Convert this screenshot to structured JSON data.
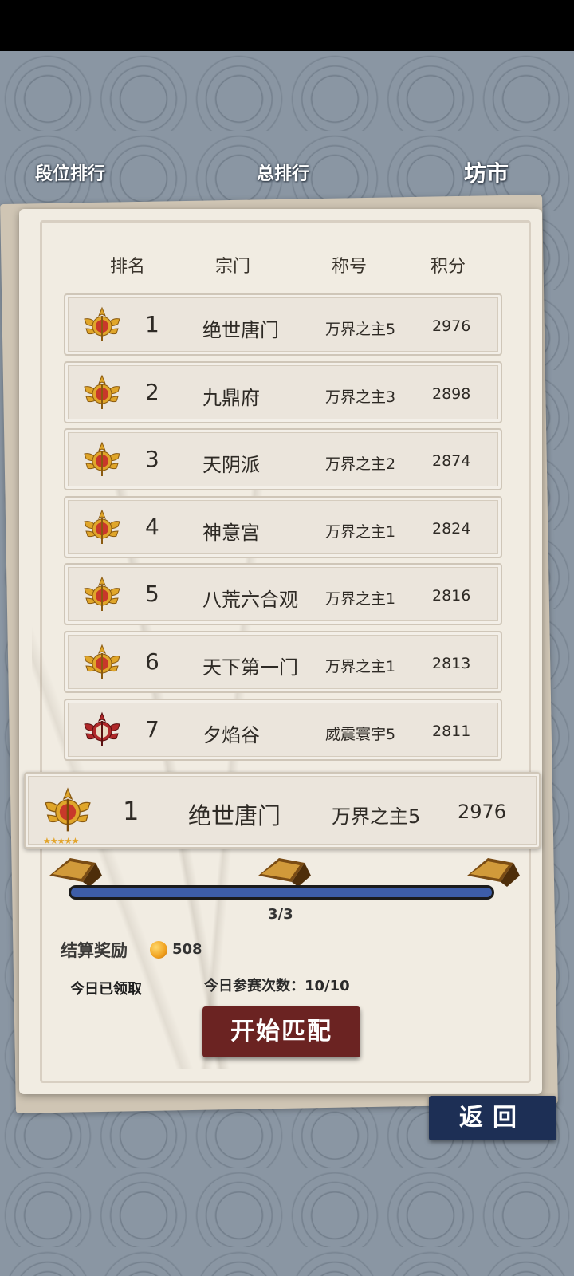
{
  "tabs": {
    "rank_tier": "段位排行",
    "rank_total": "总排行",
    "market": "坊市"
  },
  "table": {
    "headers": [
      "排名",
      "宗门",
      "称号",
      "积分"
    ],
    "rows": [
      {
        "rank": "1",
        "sect": "绝世唐门",
        "title": "万界之主5",
        "score": "2976",
        "medal": "gold"
      },
      {
        "rank": "2",
        "sect": "九鼎府",
        "title": "万界之主3",
        "score": "2898",
        "medal": "gold"
      },
      {
        "rank": "3",
        "sect": "天阴派",
        "title": "万界之主2",
        "score": "2874",
        "medal": "gold"
      },
      {
        "rank": "4",
        "sect": "神意宫",
        "title": "万界之主1",
        "score": "2824",
        "medal": "gold"
      },
      {
        "rank": "5",
        "sect": "八荒六合观",
        "title": "万界之主1",
        "score": "2816",
        "medal": "gold"
      },
      {
        "rank": "6",
        "sect": "天下第一门",
        "title": "万界之主1",
        "score": "2813",
        "medal": "gold"
      },
      {
        "rank": "7",
        "sect": "夕焰谷",
        "title": "威震寰宇5",
        "score": "2811",
        "medal": "red"
      }
    ]
  },
  "my_row": {
    "rank": "1",
    "sect": "绝世唐门",
    "title": "万界之主5",
    "score": "2976",
    "stars": "★★★★★"
  },
  "progress": {
    "text": "3/3",
    "fraction": 1.0
  },
  "reward": {
    "label": "结算奖励",
    "value": "508",
    "claimed": "今日已领取",
    "times": "今日参赛次数：10/10"
  },
  "buttons": {
    "start": "开始匹配",
    "back": "返回"
  },
  "colors": {
    "gold_medal": "#e0a62a",
    "red_medal": "#b0282a",
    "start_button": "#6b2322",
    "back_button": "#1d2f55",
    "progress_fill": "#3d5da8"
  }
}
